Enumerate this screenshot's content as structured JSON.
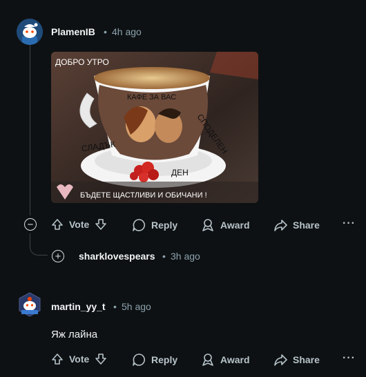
{
  "comments": [
    {
      "author": "PlamenIB",
      "separator": "•",
      "time": "4h ago",
      "image_texts": {
        "top_left": "ДОБРО УТРО",
        "cup": "КАФЕ ЗА ВАС",
        "sweet": "СЛАДЪК",
        "shared": "СПОДЕЛЕН",
        "day": "ДЕН",
        "bottom": "БЪДЕТЕ ЩАСТЛИВИ И ОБИЧАНИ !"
      },
      "actions": {
        "vote": "Vote",
        "reply": "Reply",
        "award": "Award",
        "share": "Share",
        "more": "···"
      },
      "collapse_symbol": "−"
    },
    {
      "author": "sharklovespears",
      "separator": "•",
      "time": "3h ago",
      "expand_symbol": "+"
    },
    {
      "author": "martin_yy_t",
      "separator": "•",
      "time": "5h ago",
      "body": "Яж лайна",
      "actions": {
        "vote": "Vote",
        "reply": "Reply",
        "award": "Award",
        "share": "Share",
        "more": "···"
      }
    }
  ],
  "colors": {
    "background": "#0e1113",
    "text": "#f2f4f5",
    "muted": "#8ba2ad",
    "action": "#b7c4cb",
    "thread_line": "#3d4347"
  }
}
